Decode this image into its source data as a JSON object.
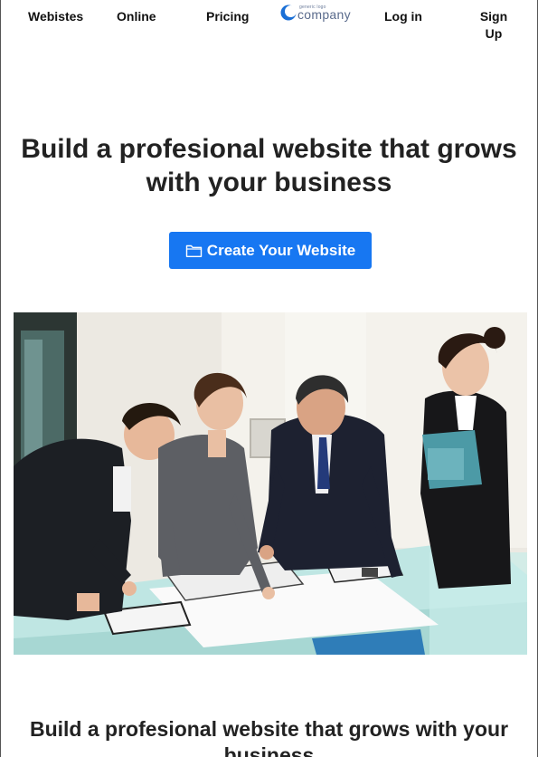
{
  "nav": {
    "websites": "Webistes",
    "online": "Online",
    "pricing": "Pricing",
    "login": "Log in",
    "signup": "Sign Up"
  },
  "logo": {
    "tagline": "generic logo",
    "wordmark": "company"
  },
  "hero": {
    "title": "Build a profesional website that grows with your business",
    "cta_label": "Create Your Website",
    "cta_icon": "folder-icon"
  },
  "photo": {
    "subject": "team-meeting-image"
  },
  "section": {
    "title": "Build a profesional website that grows with your business"
  },
  "colors": {
    "accent": "#1777f2",
    "text": "#222222"
  }
}
